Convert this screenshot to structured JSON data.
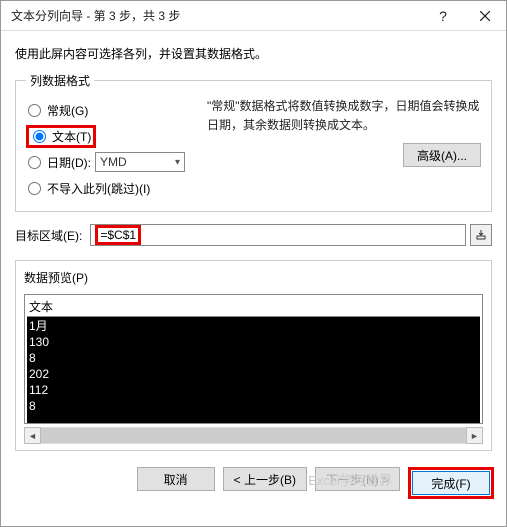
{
  "title": "文本分列向导 - 第 3 步，共 3 步",
  "instruction": "使用此屏内容可选择各列，并设置其数据格式。",
  "groupbox_label": "列数据格式",
  "radios": {
    "general": "常规(G)",
    "text": "文本(T)",
    "date": "日期(D):",
    "date_format": "YMD",
    "skip": "不导入此列(跳过)(I)"
  },
  "desc": "\"常规\"数据格式将数值转换成数字，日期值会转换成日期，其余数据则转换成文本。",
  "advanced_btn": "高级(A)...",
  "dest_label": "目标区域(E):",
  "dest_value": "=$C$1",
  "preview_label": "数据预览(P)",
  "preview_header": "文本",
  "preview_rows": [
    "1月",
    "130",
    "8",
    "202",
    "112",
    "8"
  ],
  "buttons": {
    "cancel": "取消",
    "back": "< 上一步(B)",
    "next": "下一步(N) >",
    "finish": "完成(F)"
  },
  "watermark": "Excel学习世界"
}
